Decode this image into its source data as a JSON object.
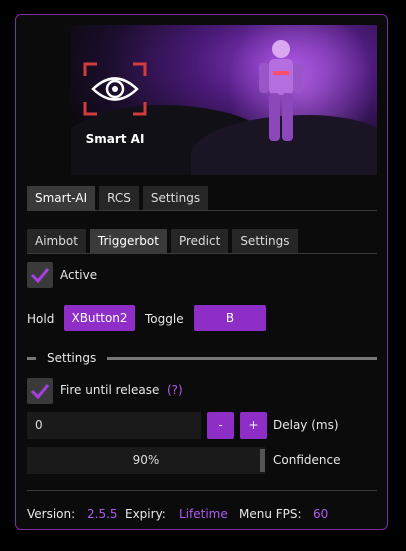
{
  "banner": {
    "title": "Smart AI"
  },
  "main_tabs": [
    {
      "label": "Smart-AI",
      "active": true
    },
    {
      "label": "RCS",
      "active": false
    },
    {
      "label": "Settings",
      "active": false
    }
  ],
  "sub_tabs": [
    {
      "label": "Aimbot",
      "active": false
    },
    {
      "label": "Triggerbot",
      "active": true
    },
    {
      "label": "Predict",
      "active": false
    },
    {
      "label": "Settings",
      "active": false
    }
  ],
  "active": {
    "label": "Active",
    "checked": true
  },
  "hold": {
    "label": "Hold",
    "key": "XButton2"
  },
  "toggle": {
    "label": "Toggle",
    "key": "B"
  },
  "settings_section": {
    "title": "Settings"
  },
  "fire_until_release": {
    "label": "Fire until release",
    "checked": true,
    "help": "(?)"
  },
  "delay": {
    "value": "0",
    "minus": "-",
    "plus": "+",
    "label": "Delay (ms)"
  },
  "confidence": {
    "value": "90%",
    "fraction": 0.9,
    "label": "Confidence"
  },
  "footer": {
    "version_label": "Version:",
    "version": "2.5.5",
    "expiry_label": "Expiry:",
    "expiry": "Lifetime",
    "fps_label": "Menu FPS:",
    "fps": "60"
  },
  "colors": {
    "accent": "#8e2ec6",
    "border": "#7a2fa3",
    "accent_text": "#b05bf0"
  }
}
